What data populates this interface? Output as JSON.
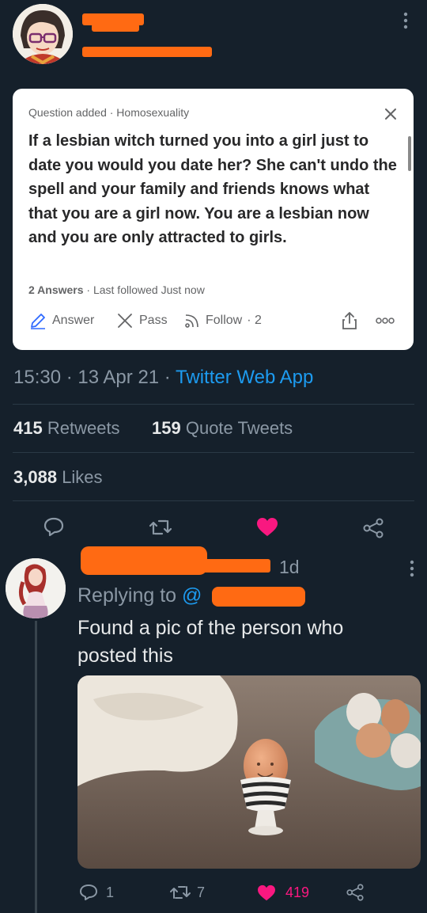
{
  "tweet": {
    "card": {
      "meta": "Question added · Homosexuality",
      "question": "If a lesbian witch turned you into a girl just to date you would you date her? She can't undo the spell and your family and friends knows what that you are a girl now. You are a lesbian now and you are only attracted to girls.",
      "answers_count": "2 Answers",
      "last_followed": "· Last followed Just now",
      "actions": {
        "answer": "Answer",
        "pass": "Pass",
        "follow": "Follow",
        "follow_count": "· 2"
      }
    },
    "timestamp": "15:30 · 13 Apr 21 ·",
    "source": "Twitter Web App",
    "retweets_count": "415",
    "retweets_label": "Retweets",
    "quotes_count": "159",
    "quotes_label": "Quote Tweets",
    "likes_count": "3,088",
    "likes_label": "Likes"
  },
  "reply": {
    "time": "1d",
    "replying_to": "Replying to",
    "handle_prefix": "@",
    "text": "Found a pic of the person who posted this",
    "reply_count": "1",
    "retweet_count": "7",
    "like_count": "419"
  },
  "colors": {
    "background": "#15202b",
    "accent": "#1d9bf0",
    "like": "#f91880",
    "redaction": "#ff6a13"
  }
}
